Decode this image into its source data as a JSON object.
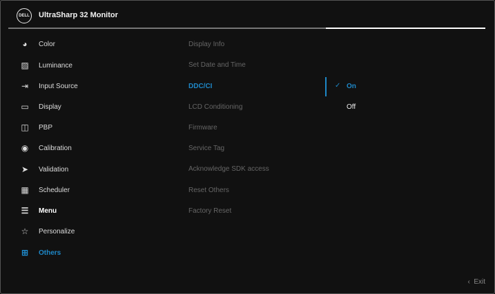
{
  "header": {
    "logo": "DELL",
    "title": "UltraSharp 32 Monitor"
  },
  "sidebar": {
    "items": [
      {
        "label": "Color",
        "icon": "palette-icon"
      },
      {
        "label": "Luminance",
        "icon": "image-icon"
      },
      {
        "label": "Input Source",
        "icon": "input-icon"
      },
      {
        "label": "Display",
        "icon": "monitor-icon"
      },
      {
        "label": "PBP",
        "icon": "split-screen-icon"
      },
      {
        "label": "Calibration",
        "icon": "target-icon"
      },
      {
        "label": "Validation",
        "icon": "validation-icon"
      },
      {
        "label": "Scheduler",
        "icon": "grid-icon"
      },
      {
        "label": "Menu",
        "icon": "menu-icon"
      },
      {
        "label": "Personalize",
        "icon": "star-icon"
      },
      {
        "label": "Others",
        "icon": "others-icon"
      }
    ]
  },
  "submenu": {
    "items": [
      "Display Info",
      "Set Date and Time",
      "DDC/CI",
      "LCD Conditioning",
      "Firmware",
      "Service Tag",
      "Acknowledge SDK access",
      "Reset Others",
      "Factory Reset"
    ]
  },
  "options": {
    "items": [
      "On",
      "Off"
    ],
    "selected": "On"
  },
  "footer": {
    "exit_label": "Exit"
  },
  "colors": {
    "accent": "#1e88c8",
    "background": "#111111"
  }
}
